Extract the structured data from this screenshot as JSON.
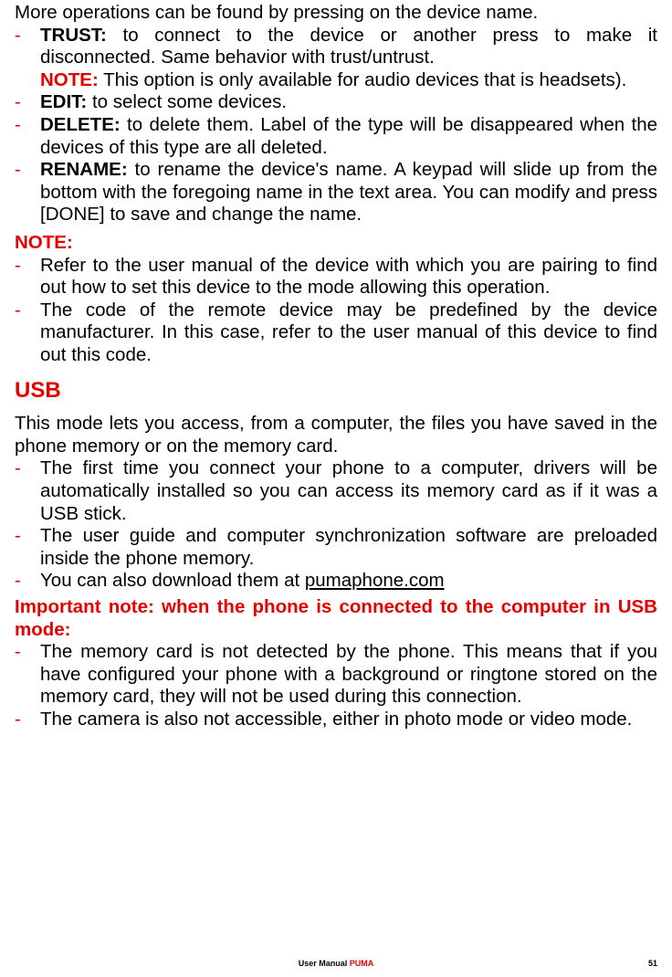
{
  "intro": "More operations can be found by pressing on the device name.",
  "ops": [
    {
      "label": "TRUST:",
      "text": " to connect to the device or another press to make it disconnected. Same behavior with trust/untrust.",
      "subnote_label": "NOTE:",
      "subnote_text": " This option is only available for audio devices that is headsets)."
    },
    {
      "label": "EDIT:",
      "text": " to select some devices."
    },
    {
      "label": "DELETE:",
      "text": " to delete them. Label of the type will be disappeared when the devices of this type are all deleted."
    },
    {
      "label": "RENAME:",
      "text": " to rename the device's name. A keypad will slide up from the bottom with the foregoing name in the text area. You can modify and press [DONE] to save and change the name."
    }
  ],
  "note_heading": "NOTE:",
  "notes": [
    "Refer to the user manual of the device with which you are pairing to find out how to set this device to the mode allowing this operation.",
    "The code of the remote device may be predefined by the device manufacturer. In this case, refer to the user manual of this device to find out this code."
  ],
  "usb_title": "USB",
  "usb_intro": "This mode lets you access, from a computer, the files you have saved in the phone memory or on the memory card.",
  "usb_items": [
    "The first time you connect your phone to a computer, drivers will be automatically installed so you can access its memory card as if it was a USB stick.",
    "The user guide and computer synchronization software are preloaded inside the phone memory."
  ],
  "usb_download_pre": "You can also download them at ",
  "usb_download_link": "pumaphone.com",
  "important_heading": "Important note: when the phone is connected to the computer in USB mode:",
  "important_items": [
    "The memory card is not detected by the phone. This means that if you have configured your phone with a background or ringtone stored on the memory card, they will not be used during this connection.",
    "The camera is also not accessible, either in photo mode or video mode."
  ],
  "footer_label": "User Manual ",
  "footer_brand": "PUMA",
  "page_number": "51"
}
